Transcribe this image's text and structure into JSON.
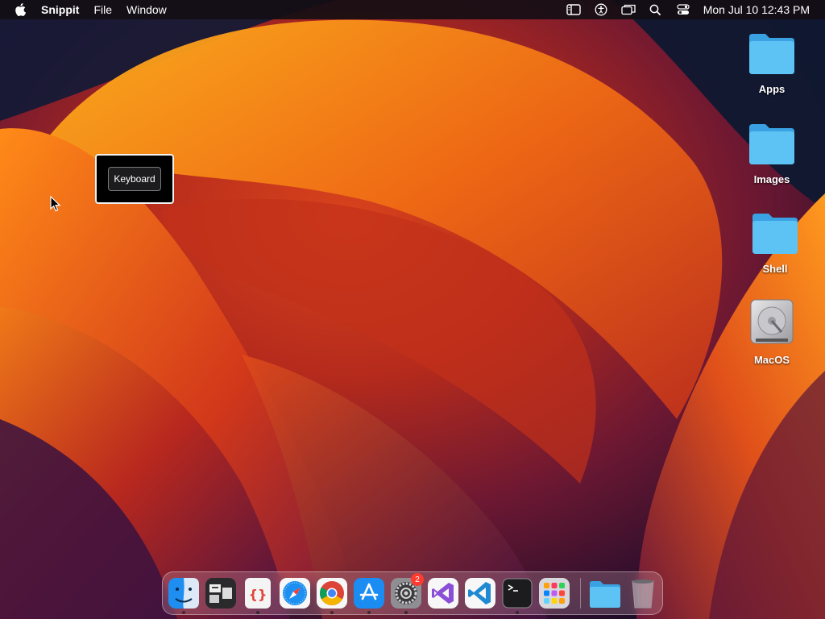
{
  "menubar": {
    "apple_icon": "apple-logo-icon",
    "app_name": "Snippit",
    "menus": [
      "File",
      "Window"
    ],
    "status_icons": [
      "sidebar-list-icon",
      "accessibility-icon",
      "screen-mirroring-icon",
      "search-icon",
      "control-center-icon"
    ],
    "clock": "Mon Jul 10  12:43 PM"
  },
  "popup": {
    "button_label": "Keyboard"
  },
  "desktop": {
    "icons": [
      {
        "label": "Apps",
        "icon": "folder-icon"
      },
      {
        "label": "Images",
        "icon": "folder-icon"
      },
      {
        "label": "Shell",
        "icon": "folder-icon"
      },
      {
        "label": "MacOS",
        "icon": "hard-drive-icon"
      }
    ]
  },
  "dock": {
    "apps": [
      {
        "name": "finder",
        "running": true
      },
      {
        "name": "snippit",
        "running": false
      },
      {
        "name": "script-editor",
        "running": true
      },
      {
        "name": "safari",
        "running": false
      },
      {
        "name": "chrome",
        "running": true
      },
      {
        "name": "app-store",
        "running": true
      },
      {
        "name": "system-settings",
        "running": true,
        "badge": "2"
      },
      {
        "name": "visual-studio",
        "running": false
      },
      {
        "name": "vscode",
        "running": false
      },
      {
        "name": "terminal",
        "running": true
      },
      {
        "name": "launchpad",
        "running": false
      },
      {
        "name": "downloads-folder",
        "running": false
      },
      {
        "name": "trash",
        "running": false
      }
    ]
  },
  "colors": {
    "folder_blue": "#4fb8ef",
    "badge_red": "#ff3b30",
    "menubar_bg": "#140e14"
  }
}
